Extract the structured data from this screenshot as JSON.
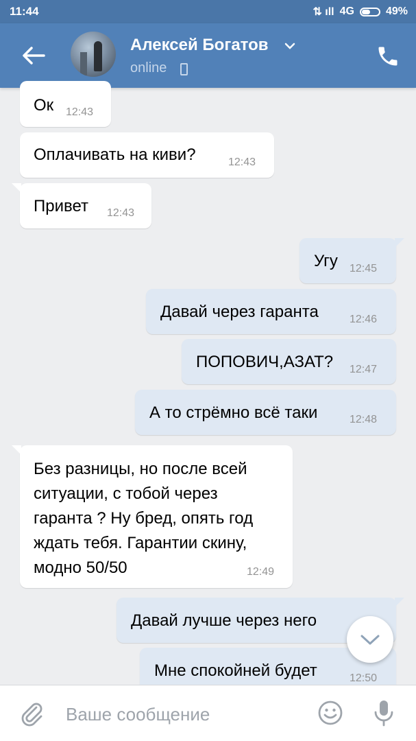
{
  "status_bar": {
    "time": "11:44",
    "network": "4G",
    "battery": "49%"
  },
  "header": {
    "contact_name": "Алексей Богатов",
    "presence": "online"
  },
  "messages": [
    {
      "text": "Ок",
      "time": "12:43"
    },
    {
      "text": "Оплачивать на киви?",
      "time": "12:43"
    },
    {
      "text": "Привет",
      "time": "12:43"
    },
    {
      "text": "Угу",
      "time": "12:45"
    },
    {
      "text": "Давай через гаранта",
      "time": "12:46"
    },
    {
      "text": "ПОПОВИЧ,АЗАТ?",
      "time": "12:47"
    },
    {
      "text": "А то стрёмно всё таки",
      "time": "12:48"
    },
    {
      "lines": [
        "Без разницы, но после всей",
        "ситуации, с тобой через",
        "гаранта ? Ну бред, опять год",
        "ждать тебя. Гарантии скину,",
        "модно 50/50"
      ],
      "time": "12:49"
    },
    {
      "text": "Давай лучше через него",
      "time": ""
    },
    {
      "text": "Мне спокойней будет",
      "time": "12:50"
    }
  ],
  "composer": {
    "placeholder": "Ваше сообщение"
  },
  "colors": {
    "header": "#5181b8",
    "statusbar": "#4a76a8",
    "outgoing": "#dfe8f3",
    "incoming": "#ffffff",
    "background": "#edeef0"
  }
}
